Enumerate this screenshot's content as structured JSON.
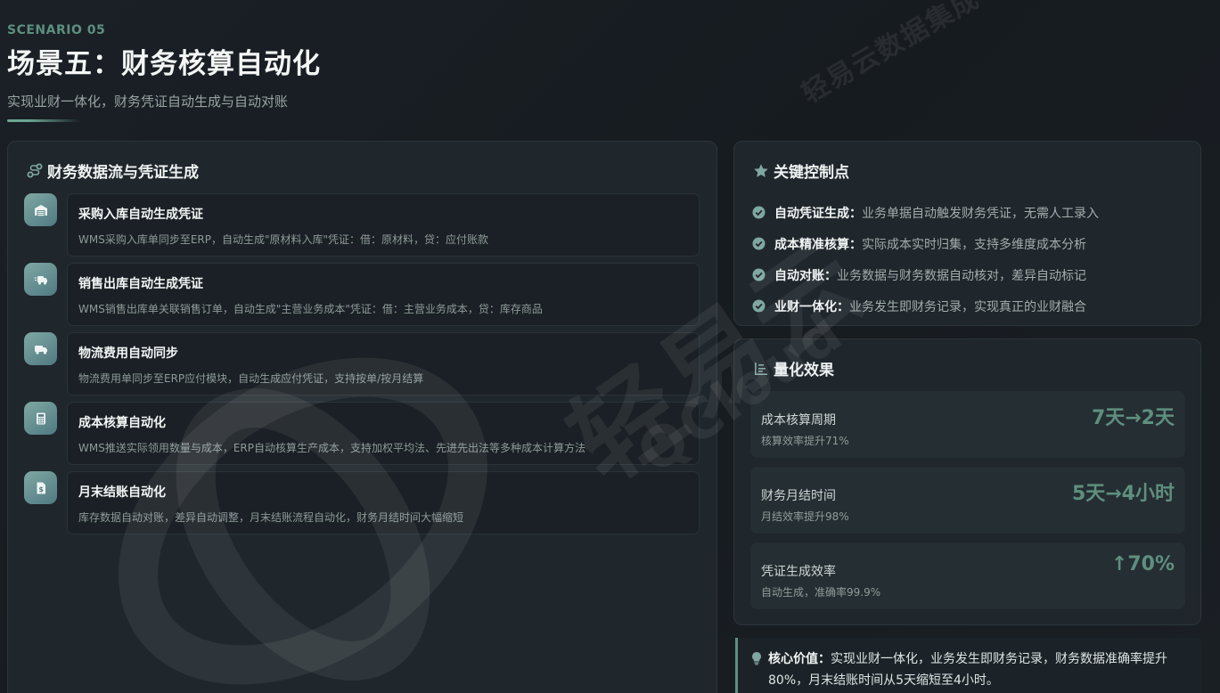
{
  "header": {
    "eyebrow": "SCENARIO 05",
    "title": "场景五：财务核算自动化",
    "subtitle": "实现业财一体化，财务凭证自动生成与自动对账"
  },
  "flow_panel": {
    "title": "财务数据流与凭证生成",
    "icon": "route-icon",
    "items": [
      {
        "icon": "warehouse-icon",
        "title": "采购入库自动生成凭证",
        "desc": "WMS采购入库单同步至ERP，自动生成\"原材料入库\"凭证：借：原材料，贷：应付账款"
      },
      {
        "icon": "truck-fast-icon",
        "title": "销售出库自动生成凭证",
        "desc": "WMS销售出库单关联销售订单，自动生成\"主营业务成本\"凭证：借：主营业务成本，贷：库存商品"
      },
      {
        "icon": "truck-icon",
        "title": "物流费用自动同步",
        "desc": "物流费用单同步至ERP应付模块，自动生成应付凭证，支持按单/按月结算"
      },
      {
        "icon": "calculator-icon",
        "title": "成本核算自动化",
        "desc": "WMS推送实际领用数量与成本，ERP自动核算生产成本，支持加权平均法、先进先出法等多种成本计算方法"
      },
      {
        "icon": "invoice-dollar-icon",
        "title": "月末结账自动化",
        "desc": "库存数据自动对账，差异自动调整，月末结账流程自动化，财务月结时间大幅缩短"
      }
    ]
  },
  "controls_panel": {
    "title": "关键控制点",
    "icon": "star-icon",
    "items": [
      {
        "key": "自动凭证生成：",
        "text": "业务单据自动触发财务凭证，无需人工录入"
      },
      {
        "key": "成本精准核算：",
        "text": "实际成本实时归集，支持多维度成本分析"
      },
      {
        "key": "自动对账：",
        "text": "业务数据与财务数据自动核对，差异自动标记"
      },
      {
        "key": "业财一体化：",
        "text": "业务发生即财务记录，实现真正的业财融合"
      }
    ]
  },
  "metrics_panel": {
    "title": "量化效果",
    "icon": "chart-list-icon",
    "items": [
      {
        "label": "成本核算周期",
        "sub": "核算效率提升71%",
        "value": "7天→2天"
      },
      {
        "label": "财务月结时间",
        "sub": "月结效率提升98%",
        "value": "5天→4小时"
      },
      {
        "label": "凭证生成效率",
        "sub": "自动生成，准确率99.9%",
        "value": "↑70%"
      }
    ]
  },
  "core_value": {
    "key": "核心价值：",
    "text": "实现业财一体化，业务发生即财务记录，财务数据准确率提升80%，月末结账时间从5天缩短至4小时。"
  },
  "watermark": {
    "small": "轻易云数据集成平台",
    "large": "轻易云",
    "english": "QCloud"
  },
  "colors": {
    "accent": "#5e8f7e",
    "background": "#171c21",
    "panel": "#1f262c",
    "icon_gradient_start": "#7fa7a3",
    "icon_gradient_end": "#4f7a82"
  }
}
